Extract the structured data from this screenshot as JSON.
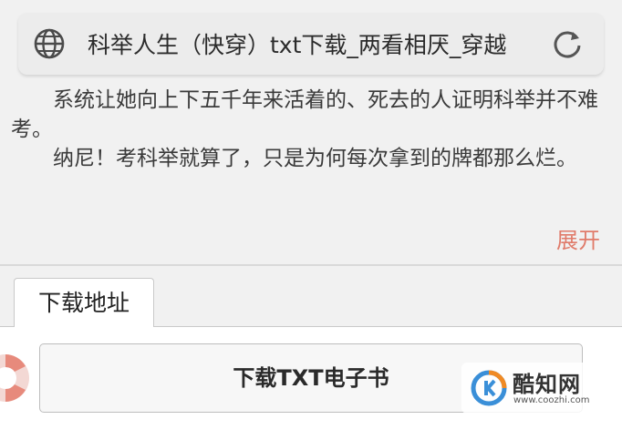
{
  "address_bar": {
    "title": "科举人生（快穿）txt下载_两看相厌_穿越",
    "left_icon": "globe-icon",
    "right_icon": "reload-icon"
  },
  "book": {
    "description_lines": [
      "系统让她向上下五千年来活着的、死去的人证明科举并不难考。",
      "纳尼！考科举就算了，只是为何每次拿到的牌都那么烂。"
    ],
    "expand_label": "展开"
  },
  "download": {
    "tab_label": "下载地址",
    "button_label": "下载TXT电子书"
  },
  "watermark": {
    "brand": "酷知网",
    "url": "www.coozhi.com"
  },
  "colors": {
    "expand_link": "#e07b6a",
    "page_bg": "#f1f1f1",
    "panel_bg": "#ffffff",
    "watermark_logo_blue": "#3a8fd8",
    "watermark_logo_orange": "#f08a24"
  }
}
